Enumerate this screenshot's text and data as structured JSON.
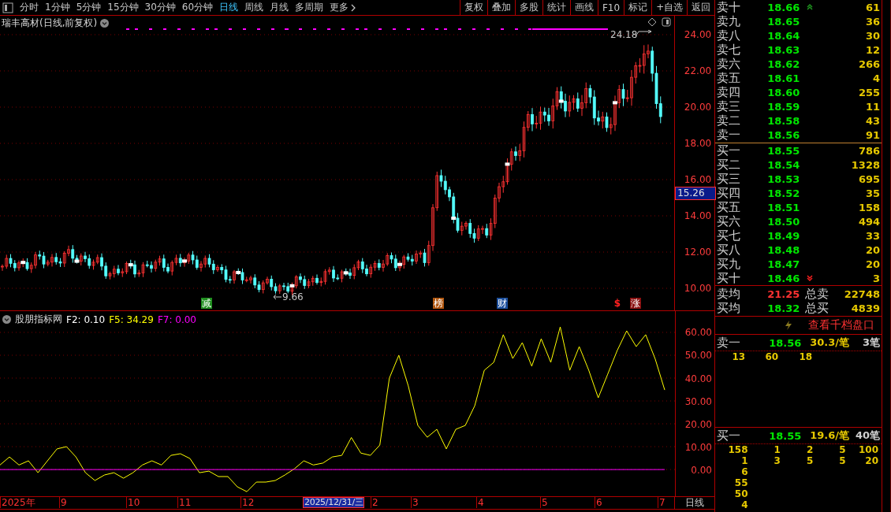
{
  "toolbar": {
    "periods": [
      {
        "label": "分时",
        "selected": false
      },
      {
        "label": "1分钟",
        "selected": false
      },
      {
        "label": "5分钟",
        "selected": false
      },
      {
        "label": "15分钟",
        "selected": false
      },
      {
        "label": "30分钟",
        "selected": false
      },
      {
        "label": "60分钟",
        "selected": false
      },
      {
        "label": "日线",
        "selected": true
      },
      {
        "label": "周线",
        "selected": false
      },
      {
        "label": "月线",
        "selected": false
      },
      {
        "label": "多周期",
        "selected": false
      }
    ],
    "more": "更多",
    "tools": [
      "复权",
      "叠加",
      "多股",
      "统计",
      "画线",
      "F10",
      "标记",
      "+自选",
      "返回"
    ]
  },
  "chart": {
    "title": "瑞丰高材(日线,前复权)",
    "price_ticks": [
      "24.00",
      "22.00",
      "20.00",
      "18.00",
      "16.00",
      "14.00",
      "12.00",
      "10.00"
    ],
    "current_price": "15.26",
    "high_label": "24.18",
    "low_label": "9.66",
    "markers": [
      {
        "text": "减",
        "kind": "badge",
        "color": "#1f8f1f"
      },
      {
        "text": "榜",
        "kind": "badge",
        "color": "#b0560e"
      },
      {
        "text": "财",
        "kind": "badge",
        "color": "#1c4f9c"
      },
      {
        "text": "$",
        "kind": "glyph",
        "color": "#ff2020"
      },
      {
        "text": "涨",
        "kind": "badge",
        "color": "#8a1010"
      }
    ]
  },
  "indicator": {
    "name": "股朋指标网",
    "legend": [
      {
        "text": "F2: 0.10",
        "color": "#ffffff"
      },
      {
        "text": "F5: 34.29",
        "color": "#ffff00"
      },
      {
        "text": "F7: 0.00",
        "color": "#ff00ff"
      }
    ],
    "chart_data": {
      "type": "line",
      "ylim": [
        -11.7,
        69.3
      ],
      "grid": true,
      "yticks": [
        {
          "value": 60,
          "label": "60.00"
        },
        {
          "value": 50,
          "label": "50.00"
        },
        {
          "value": 40,
          "label": "40.00"
        },
        {
          "value": 30,
          "label": "30.00"
        },
        {
          "value": 20,
          "label": "20.00"
        },
        {
          "value": 10,
          "label": "10.00"
        },
        {
          "value": 0,
          "label": "0.00"
        }
      ],
      "series": [
        {
          "color": "#ffff00",
          "values": [
            2,
            5.5,
            2,
            3.8,
            -1.4,
            3.8,
            9,
            10,
            5.5,
            -1.4,
            -4.8,
            -2.4,
            -1.4,
            -3.8,
            -1.4,
            2,
            3.8,
            2,
            6.2,
            6.9,
            4.8,
            -1.4,
            -0.7,
            -3.1,
            -3.1,
            -7.6,
            -9.7,
            -5.5,
            -5.5,
            -4.8,
            -2.4,
            0.3,
            3.8,
            2,
            2.8,
            5.5,
            6.2,
            14,
            7.2,
            6.2,
            10.7,
            40,
            50,
            36.6,
            19.3,
            14.1,
            17.6,
            9,
            17.6,
            19.3,
            27.9,
            43.4,
            46.9,
            59,
            48.6,
            55.5,
            45.2,
            57.2,
            46.9,
            62.4,
            43.4,
            53.8,
            43.4,
            31.4,
            41.7,
            52.1,
            60.7,
            53.8,
            59,
            48.3,
            34.8
          ]
        },
        {
          "color": "#ff00ff",
          "values": [
            0,
            0,
            0,
            0,
            0,
            0,
            0,
            0,
            0,
            0,
            0,
            0,
            0,
            0,
            0,
            0,
            0,
            0,
            0,
            0,
            0,
            0,
            0,
            0,
            0,
            0,
            0,
            0,
            0,
            0,
            0,
            0,
            0,
            0,
            0,
            0,
            0,
            0,
            0,
            0,
            0,
            0,
            0,
            0,
            0,
            0,
            0,
            0,
            0,
            0,
            0,
            0,
            0,
            0,
            0,
            0,
            0,
            0,
            0,
            0,
            0,
            0,
            0,
            0,
            0,
            0,
            0,
            0,
            0,
            0,
            0
          ]
        }
      ]
    }
  },
  "date_axis": {
    "labels": [
      {
        "text": "2025年",
        "kind": "month"
      },
      {
        "text": "9",
        "kind": "month"
      },
      {
        "text": "10",
        "kind": "month"
      },
      {
        "text": "11",
        "kind": "month"
      },
      {
        "text": "12",
        "kind": "month"
      },
      {
        "text": "2025/12/31/三",
        "kind": "cursor"
      },
      {
        "text": "2",
        "kind": "month"
      },
      {
        "text": "3",
        "kind": "month"
      },
      {
        "text": "4",
        "kind": "month"
      },
      {
        "text": "5",
        "kind": "month"
      },
      {
        "text": "6",
        "kind": "month"
      },
      {
        "text": "7",
        "kind": "month"
      }
    ],
    "period": "日线"
  },
  "order_book": {
    "asks": [
      {
        "label": "卖十",
        "price": "18.66",
        "volume": "61",
        "more_above": true
      },
      {
        "label": "卖九",
        "price": "18.65",
        "volume": "36"
      },
      {
        "label": "卖八",
        "price": "18.64",
        "volume": "30"
      },
      {
        "label": "卖七",
        "price": "18.63",
        "volume": "12"
      },
      {
        "label": "卖六",
        "price": "18.62",
        "volume": "266"
      },
      {
        "label": "卖五",
        "price": "18.61",
        "volume": "4"
      },
      {
        "label": "卖四",
        "price": "18.60",
        "volume": "255"
      },
      {
        "label": "卖三",
        "price": "18.59",
        "volume": "11"
      },
      {
        "label": "卖二",
        "price": "18.58",
        "volume": "43"
      },
      {
        "label": "卖一",
        "price": "18.56",
        "volume": "91"
      }
    ],
    "bids": [
      {
        "label": "买一",
        "price": "18.55",
        "volume": "786"
      },
      {
        "label": "买二",
        "price": "18.54",
        "volume": "1328"
      },
      {
        "label": "买三",
        "price": "18.53",
        "volume": "695"
      },
      {
        "label": "买四",
        "price": "18.52",
        "volume": "35"
      },
      {
        "label": "买五",
        "price": "18.51",
        "volume": "158"
      },
      {
        "label": "买六",
        "price": "18.50",
        "volume": "494"
      },
      {
        "label": "买七",
        "price": "18.49",
        "volume": "33"
      },
      {
        "label": "买八",
        "price": "18.48",
        "volume": "20"
      },
      {
        "label": "买九",
        "price": "18.47",
        "volume": "20"
      },
      {
        "label": "买十",
        "price": "18.46",
        "volume": "3",
        "more_below": true
      }
    ],
    "summary": [
      {
        "label": "卖均",
        "price": "21.25",
        "color": "#ff3232",
        "total_label": "总卖",
        "total": "22748"
      },
      {
        "label": "买均",
        "price": "18.32",
        "color": "#00e600",
        "total_label": "总买",
        "total": "4839"
      }
    ]
  },
  "queue": {
    "link": "查看千档盘口",
    "sections": [
      {
        "label": "卖一",
        "price": "18.56",
        "average": "30.3/笔",
        "count": "3笔",
        "rows": [
          [
            "13",
            "60",
            "18"
          ]
        ]
      },
      {
        "label": "买一",
        "price": "18.55",
        "average": "19.6/笔",
        "count": "40笔",
        "rows": [
          [
            "158",
            "1",
            "2",
            "5",
            "100"
          ],
          [
            "1",
            "3",
            "5",
            "5",
            "20"
          ],
          [
            "6"
          ],
          [
            "55"
          ],
          [
            "50"
          ],
          [
            "4"
          ]
        ]
      }
    ]
  }
}
